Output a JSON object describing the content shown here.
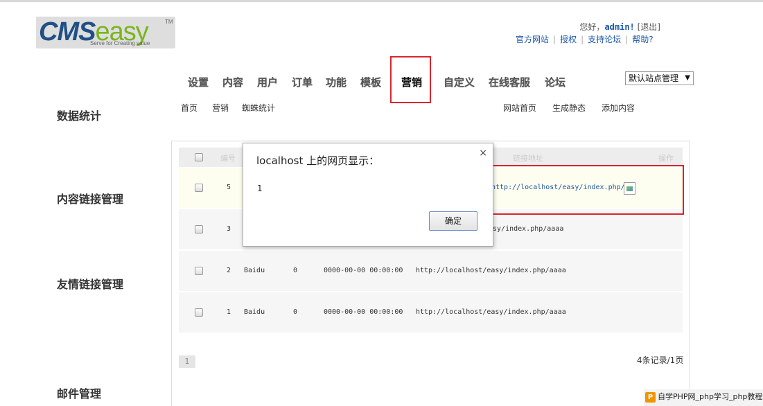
{
  "logo": {
    "text_cms": "CMS",
    "text_easy": "easy",
    "tm": "TM",
    "slogan": "Serve for Creating value"
  },
  "user": {
    "greeting": "您好，",
    "name": "admin!",
    "logout": "[退出]"
  },
  "top_links": [
    "官方网站",
    "授权",
    "支持论坛",
    "帮助?"
  ],
  "main_nav": [
    {
      "label": "设置"
    },
    {
      "label": "内容"
    },
    {
      "label": "用户"
    },
    {
      "label": "订单"
    },
    {
      "label": "功能"
    },
    {
      "label": "模板"
    },
    {
      "label": "营销"
    },
    {
      "label": "自定义"
    },
    {
      "label": "在线客服"
    },
    {
      "label": "论坛"
    }
  ],
  "site_select": {
    "value": "默认站点管理"
  },
  "sub_nav": {
    "home": "首页",
    "marketing": "营销",
    "spider": "蜘蛛统计"
  },
  "sub_right": [
    "网站首页",
    "生成静态",
    "添加内容"
  ],
  "side_headings": [
    "数据统计",
    "内容链接管理",
    "友情链接管理",
    "邮件管理"
  ],
  "table": {
    "headers": [
      "编号",
      "链接地址",
      "操作"
    ],
    "rows": [
      {
        "id": "5",
        "name": "",
        "count": "",
        "time": "",
        "url": "http://localhost/easy/index.php/"
      },
      {
        "id": "3",
        "name": "",
        "count": "",
        "time": "",
        "url": "asy/index.php/aaaa"
      },
      {
        "id": "2",
        "name": "Baidu",
        "count": "0",
        "time": "0000-00-00 00:00:00",
        "url": "http://localhost/easy/index.php/aaaa"
      },
      {
        "id": "1",
        "name": "Baidu",
        "count": "0",
        "time": "0000-00-00 00:00:00",
        "url": "http://localhost/easy/index.php/aaaa"
      }
    ]
  },
  "pager": {
    "page": "1",
    "records": "4条记录/1页"
  },
  "dialog": {
    "title": "localhost 上的网页显示：",
    "close": "×",
    "message": "1",
    "ok": "确定"
  },
  "watermark": {
    "text": "自学PHP网_php学习_php教程",
    "logo": "P"
  },
  "colors": {
    "link_blue": "#1a56a7",
    "highlight_red": "#d9252b",
    "logo_blue": "#1f4f86",
    "logo_green": "#7ab51d"
  }
}
